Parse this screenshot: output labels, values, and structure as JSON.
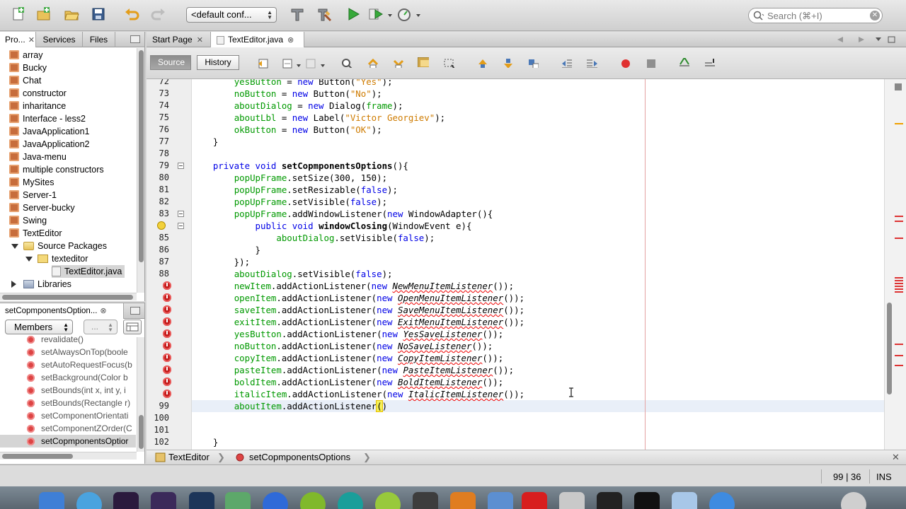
{
  "toolbar": {
    "config_select": "<default conf...",
    "search_placeholder": "Search (⌘+I)"
  },
  "projects_panel": {
    "tabs": [
      "Pro...",
      "Services",
      "Files"
    ],
    "items": [
      {
        "label": "array",
        "type": "project"
      },
      {
        "label": "Bucky",
        "type": "project"
      },
      {
        "label": "Chat",
        "type": "project"
      },
      {
        "label": "constructor",
        "type": "project"
      },
      {
        "label": "inharitance",
        "type": "project"
      },
      {
        "label": "Interface - less2",
        "type": "project"
      },
      {
        "label": "JavaApplication1",
        "type": "project"
      },
      {
        "label": "JavaApplication2",
        "type": "project"
      },
      {
        "label": "Java-menu",
        "type": "project"
      },
      {
        "label": "multiple constructors",
        "type": "project"
      },
      {
        "label": "MySites",
        "type": "project"
      },
      {
        "label": "Server-1",
        "type": "project"
      },
      {
        "label": "Server-bucky",
        "type": "project"
      },
      {
        "label": "Swing",
        "type": "project"
      },
      {
        "label": "TextEditor",
        "type": "project"
      },
      {
        "label": "Source Packages",
        "type": "folder"
      },
      {
        "label": "texteditor",
        "type": "package"
      },
      {
        "label": "TextEditor.java",
        "type": "java",
        "selected": true
      },
      {
        "label": "Libraries",
        "type": "library"
      }
    ]
  },
  "navigator": {
    "tab": "setCopmponentsOption...",
    "members_select": "Members",
    "filter_select": "...",
    "items": [
      "revalidate()",
      "setAlwaysOnTop(boole",
      "setAutoRequestFocus(b",
      "setBackground(Color b",
      "setBounds(int x, int y, i",
      "setBounds(Rectangle r)",
      "setComponentOrientati",
      "setComponentZOrder(C",
      "setCopmponentsOptior"
    ]
  },
  "editor": {
    "tabs": [
      {
        "label": "Start Page"
      },
      {
        "label": "TextEditor.java",
        "active": true
      }
    ],
    "source_button": "Source",
    "history_button": "History",
    "lines": [
      {
        "n": "72",
        "mark": "",
        "fold": false
      },
      {
        "n": "73",
        "mark": "",
        "fold": false
      },
      {
        "n": "74",
        "mark": "",
        "fold": false
      },
      {
        "n": "75",
        "mark": "",
        "fold": false
      },
      {
        "n": "76",
        "mark": "",
        "fold": false
      },
      {
        "n": "77",
        "mark": "",
        "fold": false
      },
      {
        "n": "78",
        "mark": "",
        "fold": false
      },
      {
        "n": "79",
        "mark": "",
        "fold": true
      },
      {
        "n": "80",
        "mark": "",
        "fold": false
      },
      {
        "n": "81",
        "mark": "",
        "fold": false
      },
      {
        "n": "82",
        "mark": "",
        "fold": false
      },
      {
        "n": "83",
        "mark": "",
        "fold": true
      },
      {
        "n": "",
        "mark": "bulb",
        "fold": true
      },
      {
        "n": "85",
        "mark": "",
        "fold": false
      },
      {
        "n": "86",
        "mark": "",
        "fold": false
      },
      {
        "n": "87",
        "mark": "",
        "fold": false
      },
      {
        "n": "88",
        "mark": "",
        "fold": false
      },
      {
        "n": "",
        "mark": "error",
        "fold": false
      },
      {
        "n": "",
        "mark": "error",
        "fold": false
      },
      {
        "n": "",
        "mark": "error",
        "fold": false
      },
      {
        "n": "",
        "mark": "error",
        "fold": false
      },
      {
        "n": "",
        "mark": "error",
        "fold": false
      },
      {
        "n": "",
        "mark": "error",
        "fold": false
      },
      {
        "n": "",
        "mark": "error",
        "fold": false
      },
      {
        "n": "",
        "mark": "error",
        "fold": false
      },
      {
        "n": "",
        "mark": "error",
        "fold": false
      },
      {
        "n": "",
        "mark": "error",
        "fold": false
      },
      {
        "n": "99",
        "mark": "",
        "fold": false
      },
      {
        "n": "100",
        "mark": "",
        "fold": false
      },
      {
        "n": "101",
        "mark": "",
        "fold": false
      },
      {
        "n": "102",
        "mark": "",
        "fold": false
      }
    ],
    "code": [
      [
        [
          "        ",
          ""
        ],
        [
          "yesButton",
          "fld"
        ],
        [
          " = ",
          ""
        ],
        [
          "new",
          "kw"
        ],
        [
          " Button(",
          ""
        ],
        [
          "\"Yes\"",
          "str"
        ],
        [
          ");",
          ""
        ]
      ],
      [
        [
          "        ",
          ""
        ],
        [
          "noButton",
          "fld"
        ],
        [
          " = ",
          ""
        ],
        [
          "new",
          "kw"
        ],
        [
          " Button(",
          ""
        ],
        [
          "\"No\"",
          "str"
        ],
        [
          ");",
          ""
        ]
      ],
      [
        [
          "        ",
          ""
        ],
        [
          "aboutDialog",
          "fld"
        ],
        [
          " = ",
          ""
        ],
        [
          "new",
          "kw"
        ],
        [
          " Dialog(",
          ""
        ],
        [
          "frame",
          "fld"
        ],
        [
          ");",
          ""
        ]
      ],
      [
        [
          "        ",
          ""
        ],
        [
          "aboutLbl",
          "fld"
        ],
        [
          " = ",
          ""
        ],
        [
          "new",
          "kw"
        ],
        [
          " Label(",
          ""
        ],
        [
          "\"Victor Georgiev\"",
          "str"
        ],
        [
          ");",
          ""
        ]
      ],
      [
        [
          "        ",
          ""
        ],
        [
          "okButton",
          "fld"
        ],
        [
          " = ",
          ""
        ],
        [
          "new",
          "kw"
        ],
        [
          " Button(",
          ""
        ],
        [
          "\"OK\"",
          "str"
        ],
        [
          ");",
          ""
        ]
      ],
      [
        [
          "    }",
          ""
        ]
      ],
      [
        [
          "",
          ""
        ]
      ],
      [
        [
          "    ",
          ""
        ],
        [
          "private",
          "kw"
        ],
        [
          " ",
          ""
        ],
        [
          "void",
          "kw"
        ],
        [
          " ",
          ""
        ],
        [
          "setCopmponentsOptions",
          "mth"
        ],
        [
          "(){",
          ""
        ]
      ],
      [
        [
          "        ",
          ""
        ],
        [
          "popUpFrame",
          "fld"
        ],
        [
          ".setSize(300, 150);",
          ""
        ]
      ],
      [
        [
          "        ",
          ""
        ],
        [
          "popUpFrame",
          "fld"
        ],
        [
          ".setResizable(",
          ""
        ],
        [
          "false",
          "kw"
        ],
        [
          ");",
          ""
        ]
      ],
      [
        [
          "        ",
          ""
        ],
        [
          "popUpFrame",
          "fld"
        ],
        [
          ".setVisible(",
          ""
        ],
        [
          "false",
          "kw"
        ],
        [
          ");",
          ""
        ]
      ],
      [
        [
          "        ",
          ""
        ],
        [
          "popUpFrame",
          "fld"
        ],
        [
          ".addWindowListener(",
          ""
        ],
        [
          "new",
          "kw"
        ],
        [
          " WindowAdapter(){",
          ""
        ]
      ],
      [
        [
          "            ",
          ""
        ],
        [
          "public",
          "kw"
        ],
        [
          " ",
          ""
        ],
        [
          "void",
          "kw"
        ],
        [
          " ",
          ""
        ],
        [
          "windowClosing",
          "mth"
        ],
        [
          "(WindowEvent e){",
          ""
        ]
      ],
      [
        [
          "                ",
          ""
        ],
        [
          "aboutDialog",
          "fld"
        ],
        [
          ".setVisible(",
          ""
        ],
        [
          "false",
          "kw"
        ],
        [
          ");",
          ""
        ]
      ],
      [
        [
          "            }",
          ""
        ]
      ],
      [
        [
          "        });",
          ""
        ]
      ],
      [
        [
          "        ",
          ""
        ],
        [
          "aboutDialog",
          "fld"
        ],
        [
          ".setVisible(",
          ""
        ],
        [
          "false",
          "kw"
        ],
        [
          ");",
          ""
        ]
      ],
      [
        [
          "        ",
          ""
        ],
        [
          "newItem",
          "fld"
        ],
        [
          ".addActionListener(",
          ""
        ],
        [
          "new",
          "kw"
        ],
        [
          " ",
          ""
        ],
        [
          "NewMenuItemListener",
          "err"
        ],
        [
          "());",
          ""
        ]
      ],
      [
        [
          "        ",
          ""
        ],
        [
          "openItem",
          "fld"
        ],
        [
          ".addActionListener(",
          ""
        ],
        [
          "new",
          "kw"
        ],
        [
          " ",
          ""
        ],
        [
          "OpenMenuItemListener",
          "err"
        ],
        [
          "());",
          ""
        ]
      ],
      [
        [
          "        ",
          ""
        ],
        [
          "saveItem",
          "fld"
        ],
        [
          ".addActionListener(",
          ""
        ],
        [
          "new",
          "kw"
        ],
        [
          " ",
          ""
        ],
        [
          "SaveMenuItemListener",
          "err"
        ],
        [
          "());",
          ""
        ]
      ],
      [
        [
          "        ",
          ""
        ],
        [
          "exitItem",
          "fld"
        ],
        [
          ".addActionListener(",
          ""
        ],
        [
          "new",
          "kw"
        ],
        [
          " ",
          ""
        ],
        [
          "ExitMenuItemListener",
          "err"
        ],
        [
          "());",
          ""
        ]
      ],
      [
        [
          "        ",
          ""
        ],
        [
          "yesButton",
          "fld"
        ],
        [
          ".addActionListener(",
          ""
        ],
        [
          "new",
          "kw"
        ],
        [
          " ",
          ""
        ],
        [
          "YesSaveListener",
          "err"
        ],
        [
          "());",
          ""
        ]
      ],
      [
        [
          "        ",
          ""
        ],
        [
          "noButton",
          "fld"
        ],
        [
          ".addActionListener(",
          ""
        ],
        [
          "new",
          "kw"
        ],
        [
          " ",
          ""
        ],
        [
          "NoSaveListener",
          "err"
        ],
        [
          "());",
          ""
        ]
      ],
      [
        [
          "        ",
          ""
        ],
        [
          "copyItem",
          "fld"
        ],
        [
          ".addActionListener(",
          ""
        ],
        [
          "new",
          "kw"
        ],
        [
          " ",
          ""
        ],
        [
          "CopyItemListener",
          "err"
        ],
        [
          "());",
          ""
        ]
      ],
      [
        [
          "        ",
          ""
        ],
        [
          "pasteItem",
          "fld"
        ],
        [
          ".addActionListener(",
          ""
        ],
        [
          "new",
          "kw"
        ],
        [
          " ",
          ""
        ],
        [
          "PasteItemListener",
          "err"
        ],
        [
          "());",
          ""
        ]
      ],
      [
        [
          "        ",
          ""
        ],
        [
          "boldItem",
          "fld"
        ],
        [
          ".addActionListener(",
          ""
        ],
        [
          "new",
          "kw"
        ],
        [
          " ",
          ""
        ],
        [
          "BoldItemListener",
          "err"
        ],
        [
          "());",
          ""
        ]
      ],
      [
        [
          "        ",
          ""
        ],
        [
          "italicItem",
          "fld"
        ],
        [
          ".addActionListener(",
          ""
        ],
        [
          "new",
          "kw"
        ],
        [
          " ",
          ""
        ],
        [
          "ItalicItemListener",
          "err"
        ],
        [
          "());",
          ""
        ]
      ],
      [
        [
          "        ",
          ""
        ],
        [
          "aboutItem",
          "fld"
        ],
        [
          ".addActionListener",
          ""
        ],
        [
          "(",
          "caret-hl"
        ],
        [
          ")",
          ""
        ]
      ],
      [
        [
          "",
          ""
        ]
      ],
      [
        [
          "",
          ""
        ]
      ],
      [
        [
          "    }",
          ""
        ]
      ]
    ],
    "current_line_index": 27
  },
  "breadcrumbs": [
    "TextEditor",
    "setCopmponentsOptions"
  ],
  "status": {
    "position": "99 | 36",
    "mode": "INS"
  }
}
